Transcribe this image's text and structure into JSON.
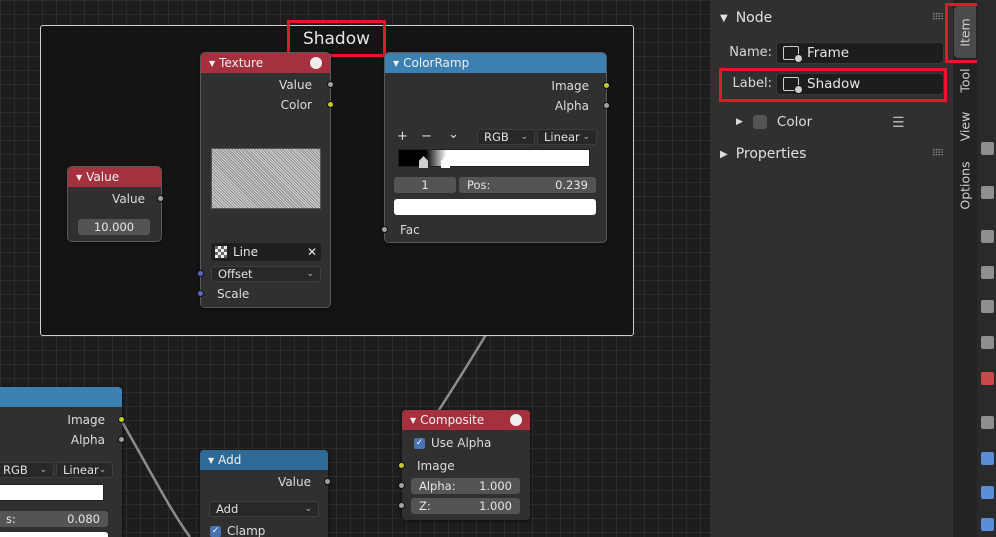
{
  "frame": {
    "label": "Shadow"
  },
  "value_node": {
    "title": "Value",
    "output": "Value",
    "value": "10.000"
  },
  "texture_node": {
    "title": "Texture",
    "outputs": [
      "Value",
      "Color"
    ],
    "image_name": "Line",
    "mapping": "Offset",
    "input": "Scale"
  },
  "colorramp_node": {
    "title": "ColorRamp",
    "outputs": [
      "Image",
      "Alpha"
    ],
    "controls": [
      "+",
      "−",
      "⌄"
    ],
    "color_mode": "RGB",
    "interpolation": "Linear",
    "index": "1",
    "pos_label": "Pos:",
    "pos_value": "0.239",
    "input": "Fac"
  },
  "composite_node": {
    "title": "Composite",
    "use_alpha_label": "Use Alpha",
    "input": "Image",
    "alpha_label": "Alpha:",
    "alpha_value": "1.000",
    "z_label": "Z:",
    "z_value": "1.000"
  },
  "bottom_left_node": {
    "outputs": [
      "Image",
      "Alpha"
    ],
    "color_mode": "RGB",
    "interpolation": "Linear",
    "pos_label": "s:",
    "pos_value": "0.080"
  },
  "add_node": {
    "title": "Add",
    "output": "Value",
    "operation": "Add",
    "clamp_label": "Clamp"
  },
  "sidebar": {
    "node_panel": "Node",
    "name_label": "Name:",
    "name_value": "Frame",
    "label_label": "Label:",
    "label_value": "Shadow",
    "color_label": "Color",
    "properties_panel": "Properties",
    "tabs": [
      "Item",
      "Tool",
      "View",
      "Options"
    ]
  },
  "colors": {
    "node_red": "#a5313e",
    "node_blue": "#3c7fb1",
    "highlight": "#e5162e",
    "socket_yellow": "#c7c729",
    "socket_grey": "#a1a1a1",
    "socket_purple": "#6363c7"
  }
}
